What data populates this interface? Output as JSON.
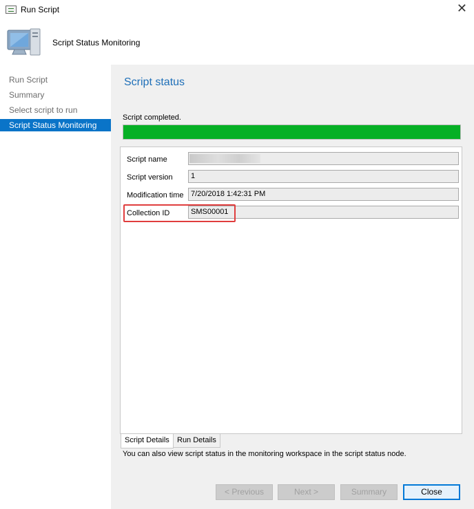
{
  "window": {
    "title": "Run Script",
    "close_glyph": "✕",
    "icon": "run-script-icon"
  },
  "header": {
    "title": "Script Status Monitoring",
    "icon": "computer-monitor-icon"
  },
  "nav": {
    "items": [
      {
        "label": "Run Script",
        "active": false
      },
      {
        "label": "Summary",
        "active": false
      },
      {
        "label": "Select script to run",
        "active": false
      },
      {
        "label": "Script Status Monitoring",
        "active": true
      }
    ]
  },
  "content": {
    "section_title": "Script status",
    "status_text": "Script completed.",
    "progress_percent": 100,
    "progress_color": "#06b025",
    "fields": {
      "script_name": {
        "label": "Script name",
        "value": ""
      },
      "script_version": {
        "label": "Script version",
        "value": "1"
      },
      "modification_time": {
        "label": "Modification time",
        "value": "7/20/2018 1:42:31 PM"
      },
      "collection_id": {
        "label": "Collection ID",
        "value": "SMS00001"
      }
    },
    "tabs": {
      "script_details": "Script Details",
      "run_details": "Run Details"
    },
    "footer_note": "You can also view script status in the monitoring workspace in the script status node."
  },
  "buttons": {
    "previous": "< Previous",
    "next": "Next >",
    "summary": "Summary",
    "close": "Close"
  },
  "colors": {
    "accent": "#0a74c8",
    "title_blue": "#1e6fb8",
    "highlight_red": "#e03d3d"
  }
}
